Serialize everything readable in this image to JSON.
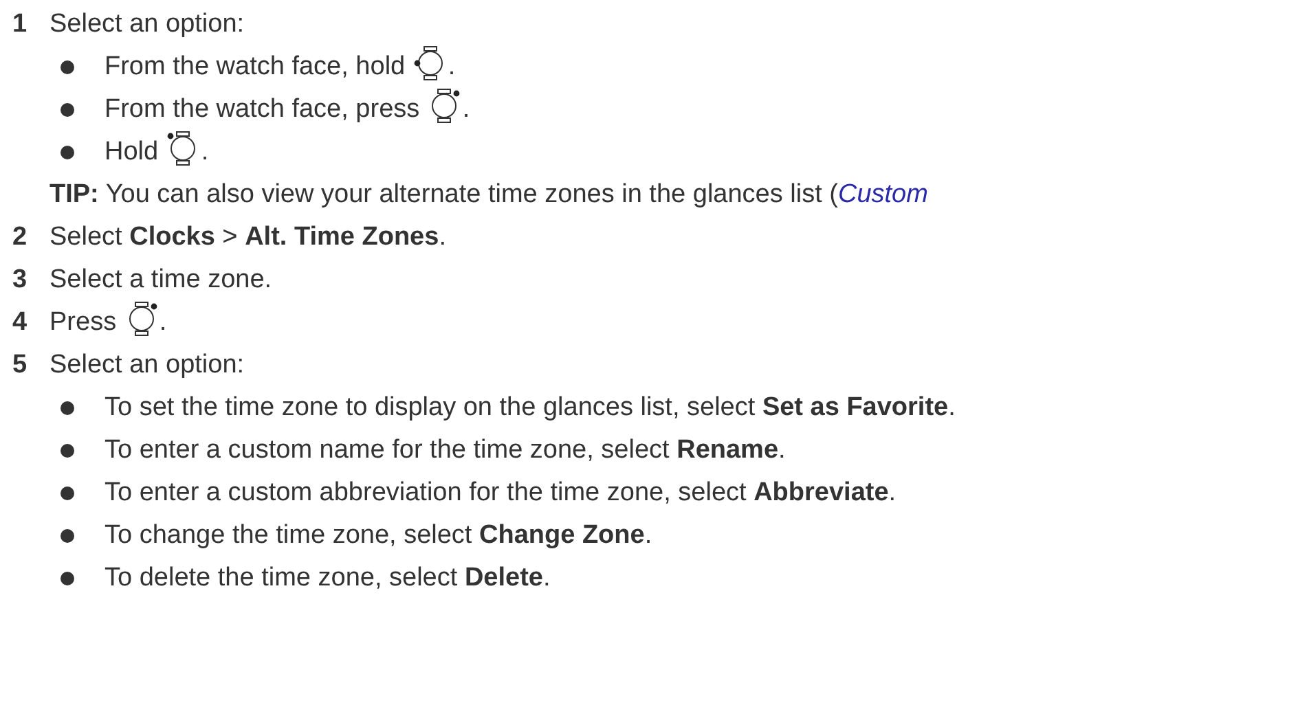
{
  "steps": [
    {
      "number": "1",
      "parts": [
        {
          "kind": "text",
          "text": "Select an option:"
        }
      ],
      "bullets": [
        [
          {
            "kind": "text",
            "text": "From the watch face, hold "
          },
          {
            "kind": "watchleft"
          },
          {
            "kind": "text",
            "text": "."
          }
        ],
        [
          {
            "kind": "text",
            "text": "From the watch face, press "
          },
          {
            "kind": "watchupright"
          },
          {
            "kind": "text",
            "text": "."
          }
        ],
        [
          {
            "kind": "text",
            "text": "Hold "
          },
          {
            "kind": "watchupleft"
          },
          {
            "kind": "text",
            "text": "."
          }
        ]
      ],
      "tip": {
        "text": "**TIP:** You can also view your alternate time zones in the glances list (",
        "link": "Custom"
      }
    },
    {
      "number": "2",
      "parts": [
        {
          "kind": "text",
          "text": "Select **Clocks** > **Alt. Time Zones**."
        }
      ]
    },
    {
      "number": "3",
      "parts": [
        {
          "kind": "text",
          "text": "Select a time zone."
        }
      ]
    },
    {
      "number": "4",
      "parts": [
        {
          "kind": "text",
          "text": "Press "
        },
        {
          "kind": "watchupright"
        },
        {
          "kind": "text",
          "text": "."
        }
      ]
    },
    {
      "number": "5",
      "parts": [
        {
          "kind": "text",
          "text": "Select an option:"
        }
      ],
      "bullets": [
        [
          {
            "kind": "text",
            "text": "To set the time zone to display on the glances list, select **Set as Favorite**."
          }
        ],
        [
          {
            "kind": "text",
            "text": "To enter a custom name for the time zone, select **Rename**."
          }
        ],
        [
          {
            "kind": "text",
            "text": "To enter a custom abbreviation for the time zone, select **Abbreviate**."
          }
        ],
        [
          {
            "kind": "text",
            "text": "To change the time zone, select **Change Zone**."
          }
        ],
        [
          {
            "kind": "text",
            "text": "To delete the time zone, select **Delete**."
          }
        ]
      ]
    }
  ]
}
